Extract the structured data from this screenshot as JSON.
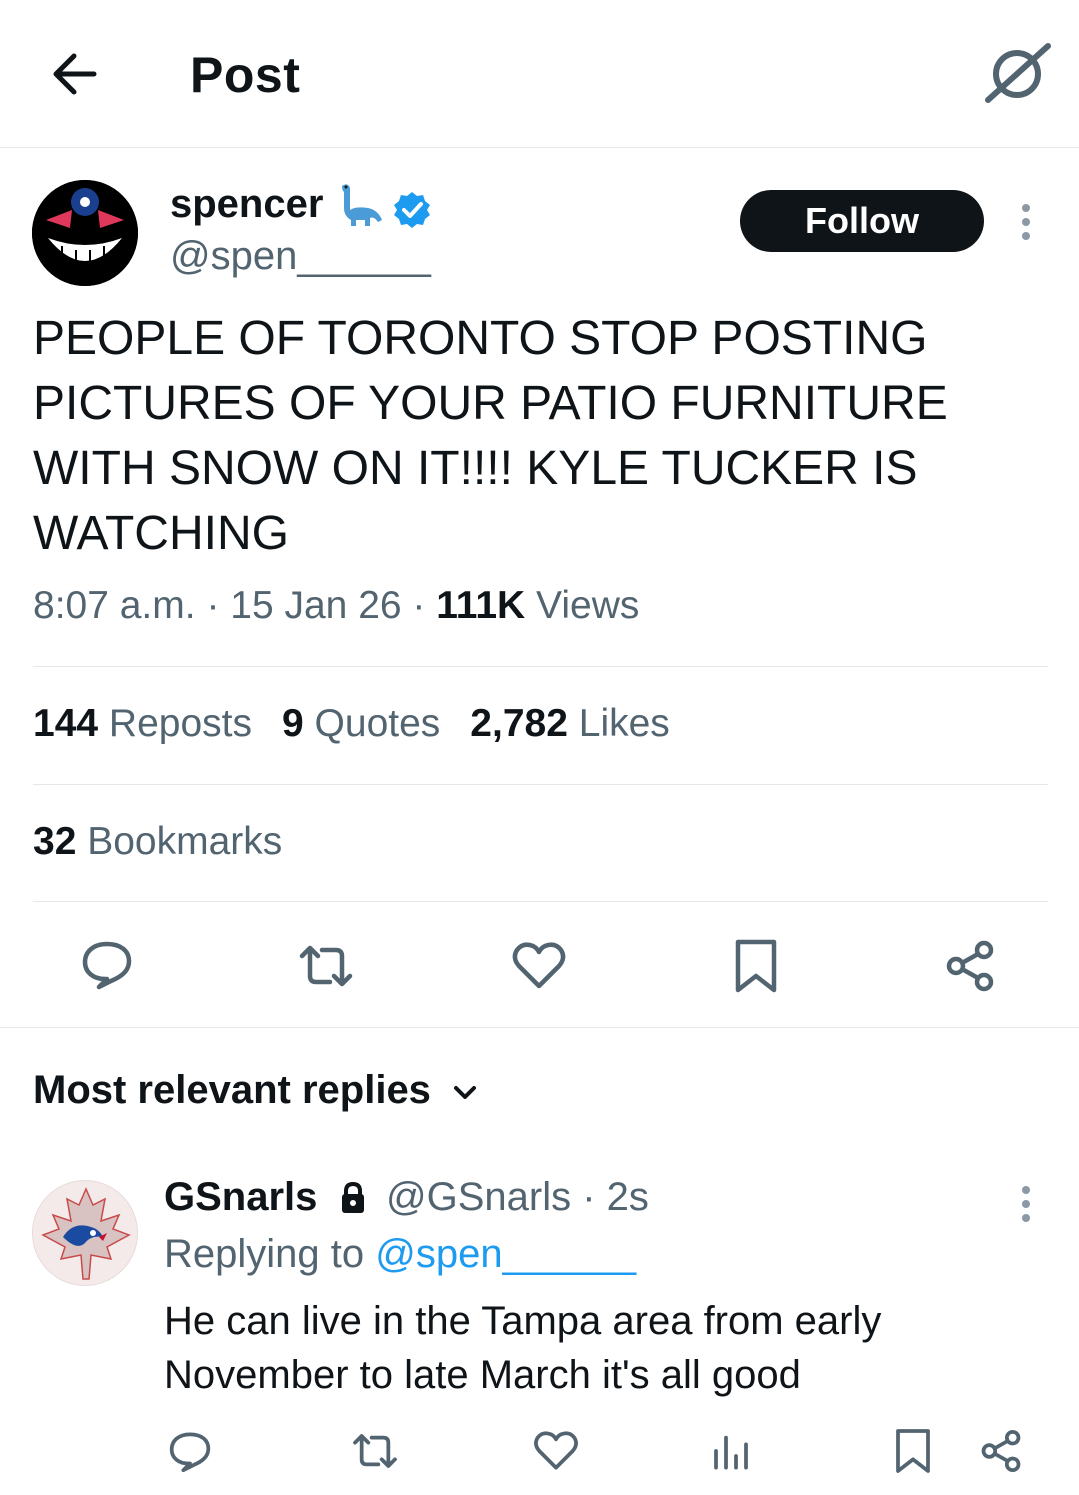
{
  "header": {
    "title": "Post",
    "back_icon": "arrow-left-icon",
    "grok_icon": "grok-icon"
  },
  "post": {
    "author": {
      "name": "spencer",
      "emoji": "🦕",
      "verified": true,
      "handle": "@spen______"
    },
    "follow_label": "Follow",
    "text": "PEOPLE OF TORONTO STOP POSTING PICTURES OF YOUR PATIO FURNITURE WITH SNOW ON IT!!!! KYLE TUCKER IS WATCHING",
    "time": "8:07 a.m.",
    "date": "15 Jan 26",
    "views_count": "111K",
    "views_label": "Views",
    "stats": {
      "reposts_count": "144",
      "reposts_label": "Reposts",
      "quotes_count": "9",
      "quotes_label": "Quotes",
      "likes_count": "2,782",
      "likes_label": "Likes",
      "bookmarks_count": "32",
      "bookmarks_label": "Bookmarks"
    },
    "actions": [
      "reply-icon",
      "repost-icon",
      "like-icon",
      "bookmark-icon",
      "share-icon"
    ]
  },
  "replies": {
    "sort_label": "Most relevant replies",
    "items": [
      {
        "name": "GSnarls",
        "protected": true,
        "handle": "@GSnarls",
        "time": "2s",
        "replying_prefix": "Replying to",
        "replying_to": "@spen______",
        "text": "He can live in the Tampa area from early November to late March it's all good",
        "actions": [
          "reply-icon",
          "repost-icon",
          "like-icon",
          "views-icon",
          "bookmark-icon",
          "share-icon"
        ]
      }
    ]
  },
  "colors": {
    "text_primary": "#0f1419",
    "text_secondary": "#536471",
    "accent": "#1d9bf0",
    "divider": "#e4e8eb"
  }
}
